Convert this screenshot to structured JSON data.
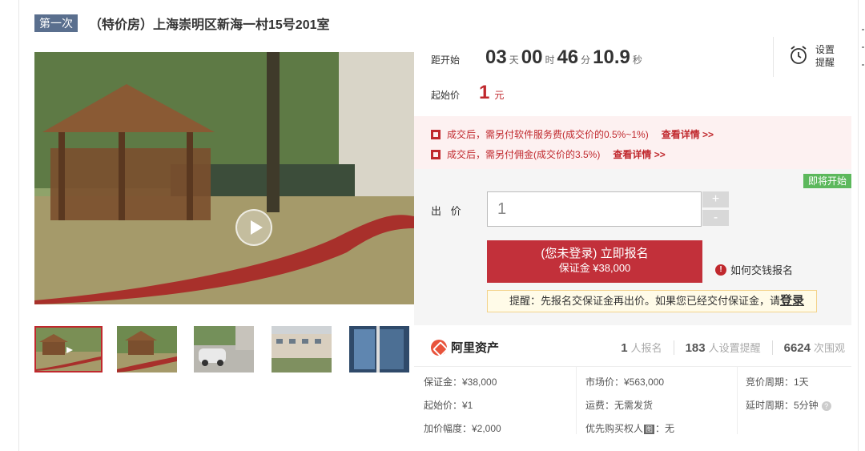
{
  "header": {
    "round_badge": "第一次",
    "title": "（特价房）上海崇明区新海一村15号201室"
  },
  "gallery": {
    "main_image": "gazebo-park-photo",
    "thumbnails": [
      "gazebo-park-photo",
      "gazebo-path-photo",
      "parked-car-photo",
      "residential-buildings-photo",
      "interior-window-photo"
    ],
    "active_index": 0
  },
  "countdown": {
    "label": "距开始",
    "days": "03",
    "days_unit": "天",
    "hours": "00",
    "hours_unit": "时",
    "minutes": "46",
    "minutes_unit": "分",
    "seconds": "10.9",
    "seconds_unit": "秒"
  },
  "reminder": {
    "line1": "设置",
    "line2": "提醒"
  },
  "start_price": {
    "label": "起始价",
    "value": "1",
    "unit": "元"
  },
  "notices": [
    {
      "text": "成交后，需另付软件服务费(成交价的0.5%~1%)",
      "link": "查看详情 >>"
    },
    {
      "text": "成交后，需另付佣金(成交价的3.5%)",
      "link": "查看详情 >>"
    }
  ],
  "bid": {
    "status_tag": "即将开始",
    "label": "出 价",
    "input_value": "1",
    "plus": "+",
    "minus": "-",
    "signup_line1": "(您未登录) 立即报名",
    "signup_line2": "保证金 ¥38,000",
    "howto": "如何交钱报名",
    "tip_text": "提醒：先报名交保证金再出价。如果您已经交付保证金，请",
    "tip_login": "登录"
  },
  "platform": {
    "name": "阿里资产",
    "stats": [
      {
        "num": "1",
        "unit": "人报名"
      },
      {
        "num": "183",
        "unit": "人设置提醒"
      },
      {
        "num": "6624",
        "unit": "次围观"
      }
    ]
  },
  "info": {
    "deposit": "保证金：¥38,000",
    "start": "起始价：¥1",
    "increment": "加价幅度：¥2,000",
    "market": "市场价：¥563,000",
    "shipping": "运费：无需发货",
    "priority_prefix": "优先购买权人",
    "priority_badge": "图",
    "priority_suffix": "：无",
    "cycle": "竞价周期：1天",
    "delay": "延时周期：5分钟"
  },
  "colors": {
    "accent_red": "#c0282d",
    "badge_blue": "#5a6f8e",
    "status_green": "#5cb85c"
  }
}
